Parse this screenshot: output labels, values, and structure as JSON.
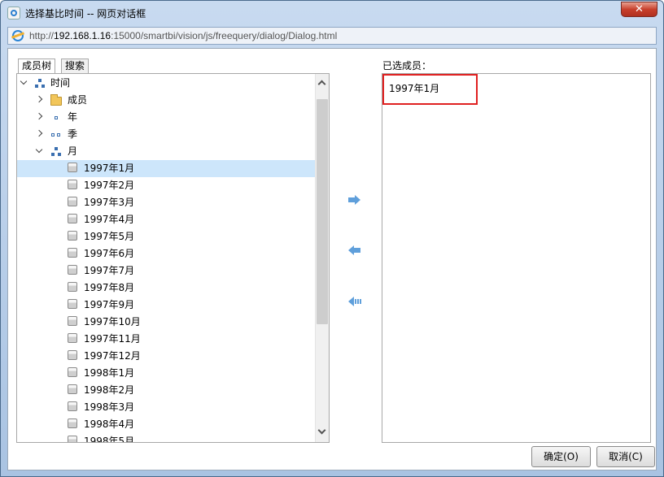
{
  "window": {
    "title": "选择基比时间 -- 网页对话框",
    "close_label": "✕"
  },
  "address": {
    "scheme": "http://",
    "host": "192.168.1.16",
    "path": ":15000/smartbi/vision/js/freequery/dialog/Dialog.html"
  },
  "tabs": [
    {
      "label": "成员树",
      "active": true
    },
    {
      "label": "搜索",
      "active": false
    }
  ],
  "tree": {
    "root": {
      "label": "时间",
      "icon": "hierarchy-icon",
      "expanded": true
    },
    "groups": [
      {
        "label": "成员",
        "icon": "folder-icon",
        "expanded": false
      },
      {
        "label": "年",
        "icon": "level-year-icon",
        "expanded": false
      },
      {
        "label": "季",
        "icon": "level-quarter-icon",
        "expanded": false
      },
      {
        "label": "月",
        "icon": "level-month-icon",
        "expanded": true
      }
    ],
    "members": [
      "1997年1月",
      "1997年2月",
      "1997年3月",
      "1997年4月",
      "1997年5月",
      "1997年6月",
      "1997年7月",
      "1997年8月",
      "1997年9月",
      "1997年10月",
      "1997年11月",
      "1997年12月",
      "1998年1月",
      "1998年2月",
      "1998年3月",
      "1998年4月",
      "1998年5月"
    ],
    "selected_member": "1997年1月"
  },
  "transfer": {
    "add_icon": "arrow-right-icon",
    "remove_icon": "arrow-left-icon",
    "remove_all_icon": "arrow-left-all-icon"
  },
  "selected_panel": {
    "label": "已选成员：",
    "items": [
      "1997年1月"
    ],
    "highlight_color": "#e02020"
  },
  "buttons": {
    "ok": "确定(O)",
    "cancel": "取消(C)"
  },
  "colors": {
    "selection": "#cde6fb",
    "arrow": "#5f9fdb"
  }
}
